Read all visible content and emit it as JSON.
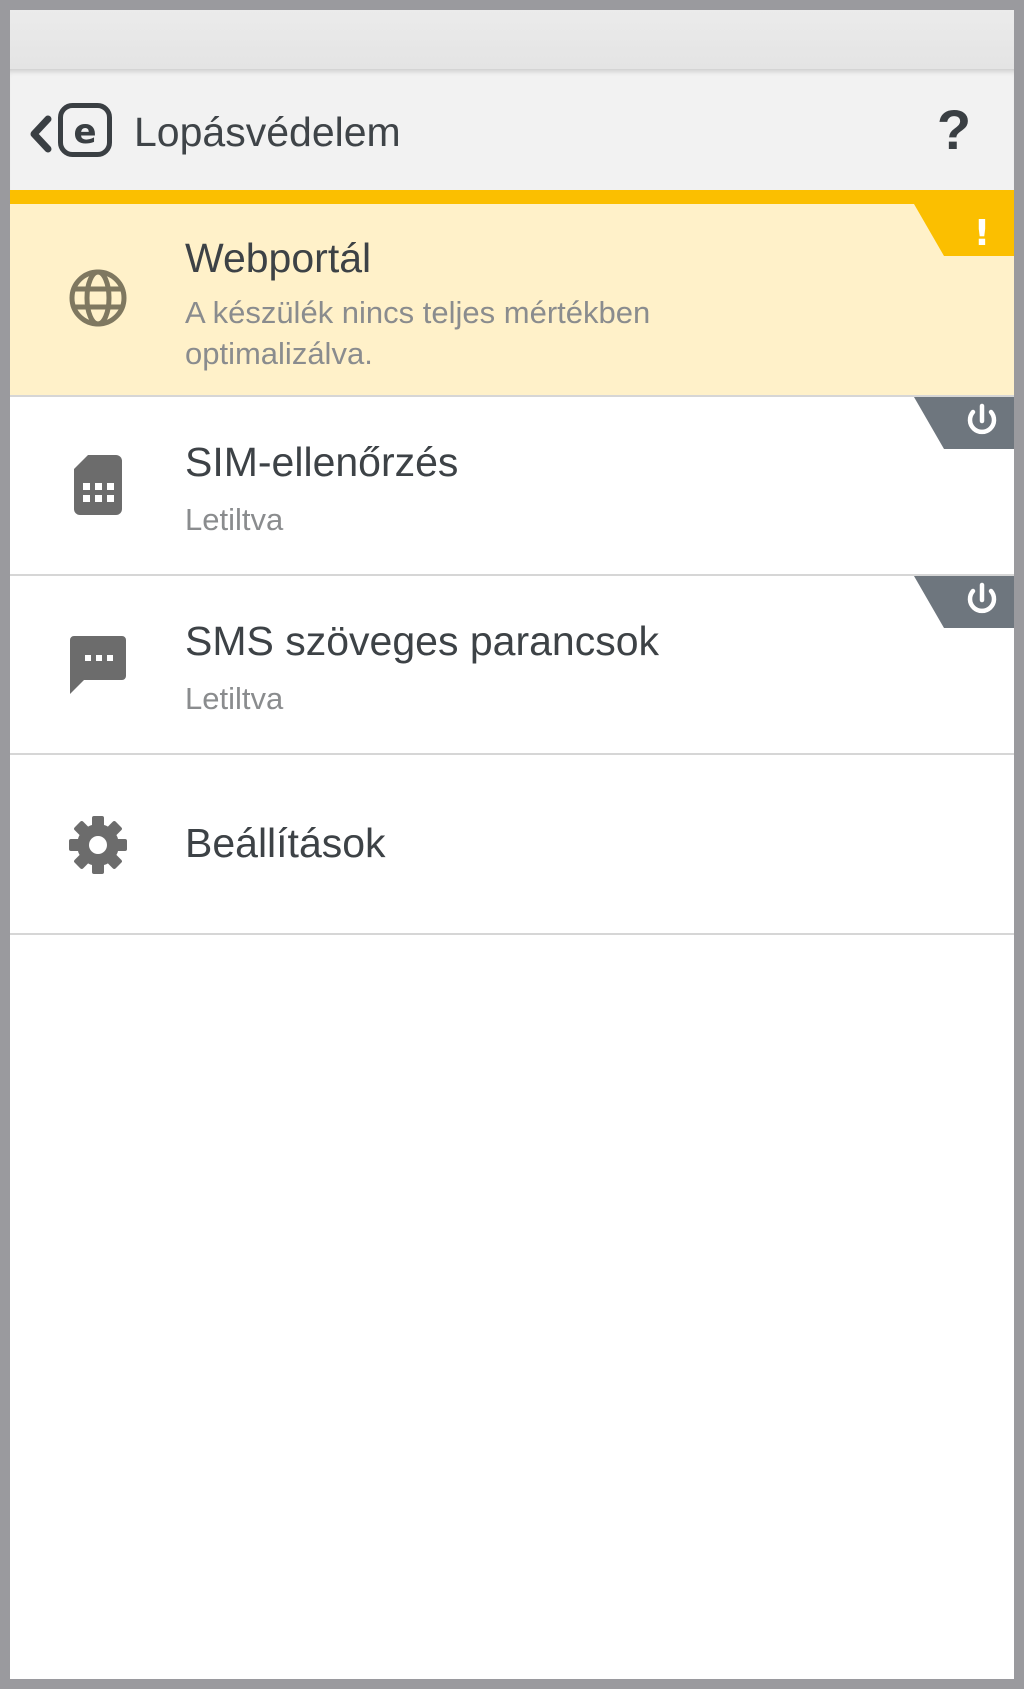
{
  "header": {
    "title": "Lopásvédelem",
    "help_label": "?",
    "logo_letter": "e"
  },
  "colors": {
    "accent_yellow": "#fbbf00",
    "warning_bg": "#fff1c9",
    "badge_gray": "#6e767e",
    "icon_gray": "#6c6c6c",
    "globe_olive": "#7f7860"
  },
  "items": [
    {
      "title": "Webportál",
      "subtitle": "A készülék nincs teljes mértékben optimalizálva.",
      "icon": "globe-icon",
      "badge": "warning-exclamation-icon",
      "badge_text": "!",
      "state": "warning"
    },
    {
      "title": "SIM-ellenőrzés",
      "subtitle": "Letiltva",
      "icon": "sim-card-icon",
      "badge": "power-icon",
      "state": "disabled"
    },
    {
      "title": "SMS szöveges parancsok",
      "subtitle": "Letiltva",
      "icon": "sms-message-icon",
      "badge": "power-icon",
      "state": "disabled"
    },
    {
      "title": "Beállítások",
      "icon": "gear-icon"
    }
  ]
}
